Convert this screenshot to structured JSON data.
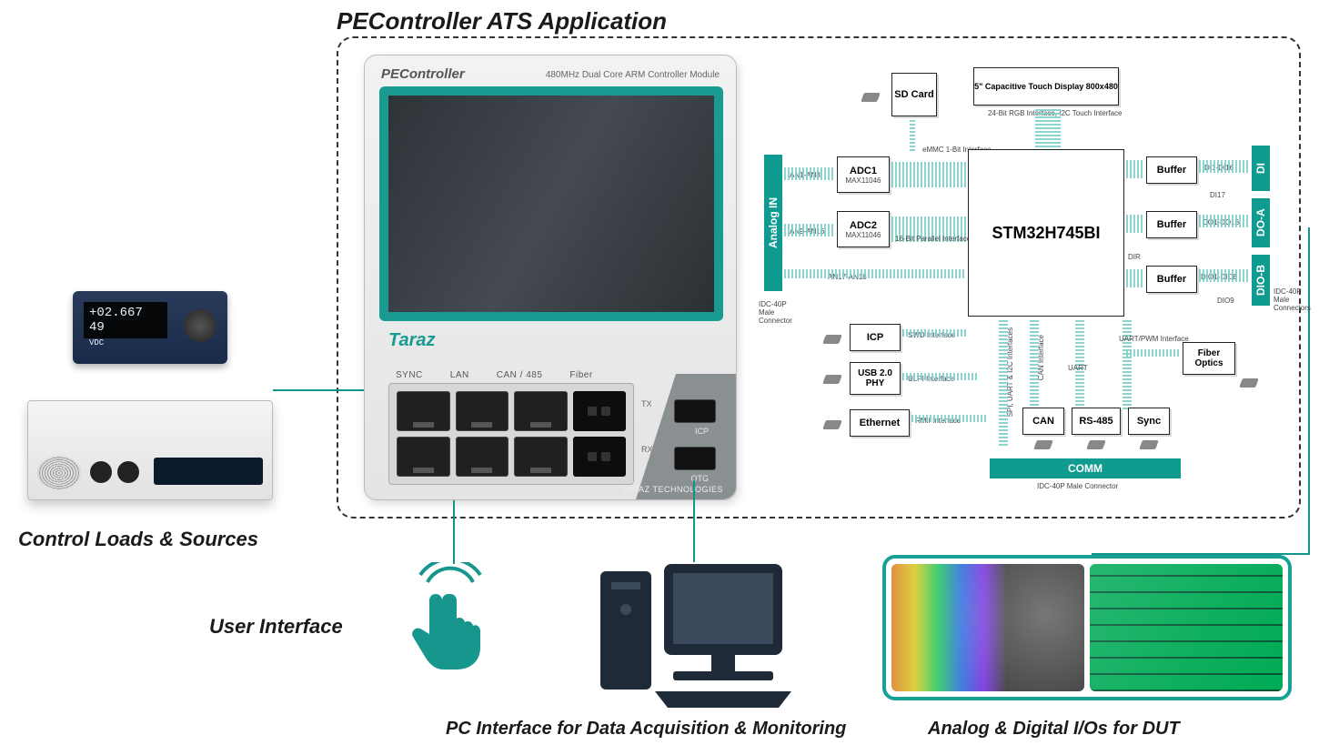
{
  "title": "PEController ATS Application",
  "labels": {
    "loads": "Control Loads & Sources",
    "ui": "User Interface",
    "pc": "PC Interface for Data Acquisition & Monitoring",
    "dut": "Analog & Digital I/Os for DUT"
  },
  "multimeter": {
    "reading": "+02.667 49",
    "unit": "VDC"
  },
  "device": {
    "name": "PEController",
    "subtitle": "480MHz Dual Core ARM Controller Module",
    "brand": "Taraz",
    "footer": "TARAZ TECHNOLOGIES",
    "port_labels": {
      "sync": "SYNC",
      "lan": "LAN",
      "can": "CAN / 485",
      "fiber": "Fiber"
    },
    "tx": "TX",
    "rx": "RX",
    "usb1": "ICP",
    "usb2": "OTG"
  },
  "bd": {
    "analog_in": "Analog IN",
    "an_ranges": {
      "a": "AN1-AN8",
      "b": "AN9-AN16",
      "c": "AN17-AN18"
    },
    "adc1": "ADC1",
    "adc2": "ADC2",
    "adc_sub": "MAX11046",
    "sd": "SD Card",
    "display": "5\" Capacitive Touch Display 800x480",
    "display_if": "24-Bit RGB Interface, I2C Touch Interface",
    "emmc": "eMMC 1-Bit Interface",
    "parallel": "16-Bit Parallel Interface",
    "cpu": "STM32H745BI",
    "icp": "ICP",
    "swd": "SWD Interface",
    "usbphy": "USB 2.0 PHY",
    "ulpi": "ULPI Interface",
    "eth": "Ethernet",
    "rmii": "RMII Interface",
    "spi": "SPI, UART & I2C Interfaces",
    "can_if": "CAN Interface",
    "uart": "UART",
    "uartpwm": "UART/PWM Interface",
    "can": "CAN",
    "rs485": "RS-485",
    "sync": "Sync",
    "fiber": "Fiber Optics",
    "comm": "COMM",
    "buffer": "Buffer",
    "di": "DI",
    "doa": "DO-A",
    "diob": "DIO-B",
    "di_r": "DI1-DI16",
    "di17": "DI17",
    "do_r": "DO1-DO16",
    "dio_r": "DIO1-DIO8",
    "dio9": "DIO9",
    "dir": "DIR",
    "idc_left": "IDC-40P Male Connector",
    "idc_right": "IDC-40P Male Connectors",
    "idc_bottom": "IDC-40P Male Connector"
  }
}
